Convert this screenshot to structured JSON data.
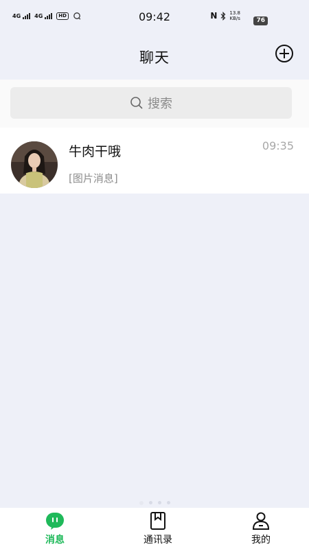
{
  "status_bar": {
    "signal1": "4G",
    "signal2": "4G",
    "hd": "HD",
    "time": "09:42",
    "speed_value": "13.8",
    "speed_unit": "KB/s",
    "nfc": "N",
    "battery": "76"
  },
  "header": {
    "title": "聊天"
  },
  "search": {
    "placeholder": "搜索"
  },
  "chats": [
    {
      "name": "牛肉干哦",
      "last_message": "[图片消息]",
      "time": "09:35"
    }
  ],
  "tabs": [
    {
      "label": "消息",
      "icon": "message-icon",
      "active": true
    },
    {
      "label": "通讯录",
      "icon": "contacts-icon",
      "active": false
    },
    {
      "label": "我的",
      "icon": "profile-icon",
      "active": false
    }
  ],
  "colors": {
    "accent": "#1fb95a",
    "background": "#eef0f8"
  }
}
